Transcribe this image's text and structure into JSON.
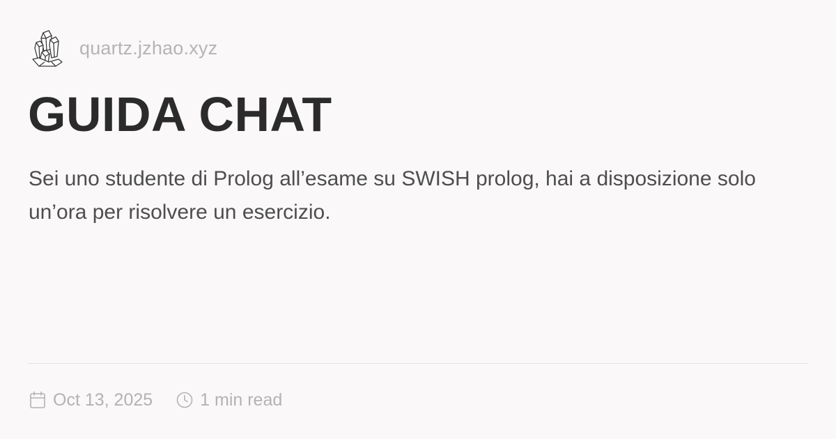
{
  "site": {
    "name": "quartz.jzhao.xyz",
    "logo_icon": "crystal-icon"
  },
  "post": {
    "title": "GUIDA CHAT",
    "description": "Sei uno studente di Prolog all’esame su SWISH prolog, hai a disposizione solo un’ora per risolvere un esercizio."
  },
  "meta": {
    "date": "Oct 13, 2025",
    "date_icon": "calendar-icon",
    "reading_time": "1 min read",
    "reading_time_icon": "clock-icon"
  },
  "colors": {
    "background": "#faf8f8",
    "title": "#2b2b2b",
    "body_text": "#4e4e4e",
    "muted_text": "#b5b5b5",
    "divider": "#e6e3e3"
  }
}
